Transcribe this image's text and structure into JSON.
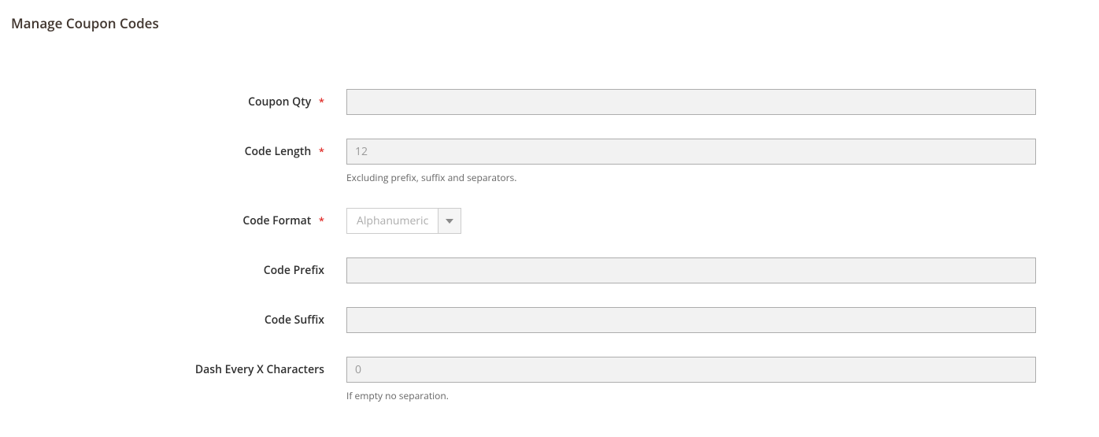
{
  "section": {
    "title": "Manage Coupon Codes"
  },
  "fields": {
    "coupon_qty": {
      "label": "Coupon Qty",
      "value": ""
    },
    "code_length": {
      "label": "Code Length",
      "placeholder": "12",
      "value": "",
      "note": "Excluding prefix, suffix and separators."
    },
    "code_format": {
      "label": "Code Format",
      "value": "Alphanumeric"
    },
    "code_prefix": {
      "label": "Code Prefix",
      "value": ""
    },
    "code_suffix": {
      "label": "Code Suffix",
      "value": ""
    },
    "dash_every": {
      "label": "Dash Every X Characters",
      "placeholder": "0",
      "value": "",
      "note": "If empty no separation."
    }
  },
  "required_marker": "*"
}
